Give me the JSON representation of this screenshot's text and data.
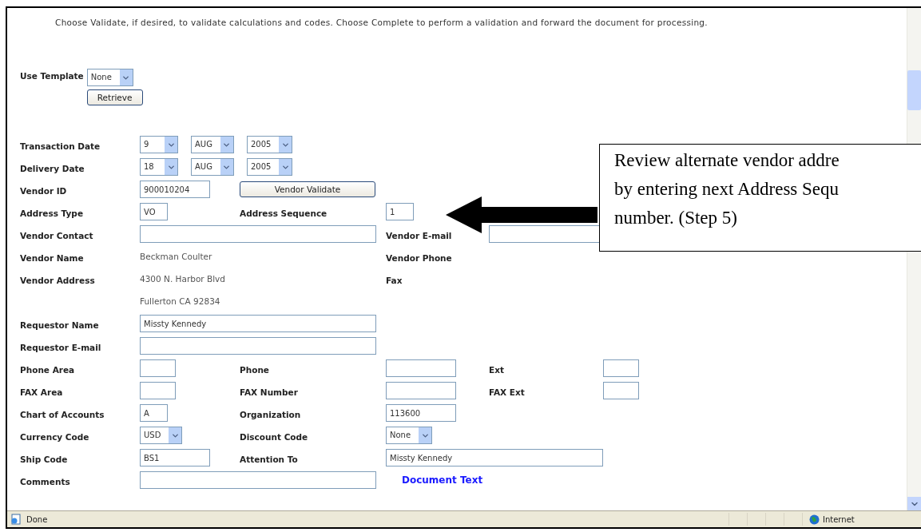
{
  "instructions": "Choose Validate, if desired, to validate calculations and codes. Choose Complete to perform a validation and forward the document for processing.",
  "use_template": {
    "label": "Use Template",
    "value": "None",
    "button": "Retrieve"
  },
  "rows": [
    {
      "label": "Transaction Date",
      "cells": [
        {
          "kind": "date",
          "selects": [
            "9",
            "AUG",
            "2005"
          ]
        }
      ]
    },
    {
      "label": "Delivery Date",
      "cells": [
        {
          "kind": "date",
          "selects": [
            "18",
            "AUG",
            "2005"
          ]
        }
      ]
    },
    {
      "label": "Vendor ID",
      "cells": [
        {
          "kind": "field_m",
          "value": "900010204"
        },
        {
          "kind": "button",
          "text": "Vendor Validate"
        }
      ]
    },
    {
      "label": "Address Type",
      "cells": [
        {
          "kind": "field_xs",
          "value": "VO"
        },
        {
          "kind": "label",
          "text": "Address Sequence"
        },
        {
          "kind": "field_xs",
          "value": "1"
        }
      ]
    },
    {
      "label": "Vendor Contact",
      "cells": [
        {
          "kind": "field_w"
        },
        {
          "kind": "label",
          "text": "Vendor E-mail"
        },
        {
          "kind": "field_w"
        }
      ]
    },
    {
      "label": "Vendor Name",
      "cells": [
        {
          "kind": "text",
          "text": "Beckman Coulter"
        },
        {
          "kind": "label",
          "text": "Vendor Phone"
        }
      ]
    },
    {
      "label": "Vendor Address",
      "cells": [
        {
          "kind": "text",
          "text": "4300 N. Harbor Blvd"
        },
        {
          "kind": "label",
          "text": "Fax"
        }
      ]
    },
    {
      "cells": [
        {
          "kind": "text",
          "text": "Fullerton CA 92834"
        }
      ]
    },
    {
      "label": "Requestor Name",
      "cells": [
        {
          "kind": "field_w",
          "value": "Missty Kennedy"
        }
      ]
    },
    {
      "label": "Requestor E-mail",
      "cells": [
        {
          "kind": "field_w"
        }
      ]
    },
    {
      "label": "Phone Area",
      "cells": [
        {
          "kind": "field_s"
        },
        {
          "kind": "label",
          "text": "Phone"
        },
        {
          "kind": "field_m"
        },
        {
          "kind": "label",
          "text": "Ext"
        },
        {
          "kind": "field_s"
        }
      ]
    },
    {
      "label": "FAX Area",
      "cells": [
        {
          "kind": "field_s"
        },
        {
          "kind": "label",
          "text": "FAX Number"
        },
        {
          "kind": "field_m"
        },
        {
          "kind": "label",
          "text": "FAX Ext"
        },
        {
          "kind": "field_s"
        }
      ]
    },
    {
      "label": "Chart of Accounts",
      "cells": [
        {
          "kind": "field_xs",
          "value": "A"
        },
        {
          "kind": "label",
          "text": "Organization"
        },
        {
          "kind": "field_m",
          "value": "113600"
        }
      ]
    },
    {
      "label": "Currency Code",
      "cells": [
        {
          "kind": "select",
          "value": "USD"
        },
        {
          "kind": "label",
          "text": "Discount Code"
        },
        {
          "kind": "select",
          "value": "None"
        }
      ]
    },
    {
      "label": "Ship Code",
      "cells": [
        {
          "kind": "field_m",
          "value": "BS1"
        },
        {
          "kind": "label",
          "text": "Attention To"
        },
        {
          "kind": "field_w",
          "value": "Missty Kennedy"
        }
      ]
    },
    {
      "label": "Comments",
      "cells": [
        {
          "kind": "field_w"
        },
        {
          "kind": "link",
          "text": "Document Text"
        }
      ]
    }
  ],
  "callout": {
    "lines": [
      "Review alternate vendor addre",
      "by entering next Address Sequ",
      "number. (Step 5)"
    ]
  },
  "status_bar": {
    "status": "Done",
    "zone": "Internet"
  }
}
